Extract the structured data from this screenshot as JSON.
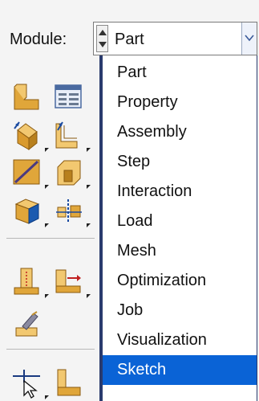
{
  "module": {
    "label": "Module:",
    "selected": "Part"
  },
  "dropdown": {
    "items": [
      {
        "label": "Part",
        "selected": false
      },
      {
        "label": "Property",
        "selected": false
      },
      {
        "label": "Assembly",
        "selected": false
      },
      {
        "label": "Step",
        "selected": false
      },
      {
        "label": "Interaction",
        "selected": false
      },
      {
        "label": "Load",
        "selected": false
      },
      {
        "label": "Mesh",
        "selected": false
      },
      {
        "label": "Optimization",
        "selected": false
      },
      {
        "label": "Job",
        "selected": false
      },
      {
        "label": "Visualization",
        "selected": false
      },
      {
        "label": "Sketch",
        "selected": true
      }
    ],
    "highlight_color": "#0a63d6"
  },
  "toolbar": {
    "icons": [
      "create-part-icon",
      "part-manager-icon",
      "extrude-solid-icon",
      "extrude-cut-icon",
      "create-wire-icon",
      "create-cut-icon",
      "create-solid-icon",
      "partition-icon",
      "datum-point-icon",
      "datum-axis-icon",
      "geometry-repair-icon",
      "query-icon",
      "create-feature-icon"
    ]
  }
}
